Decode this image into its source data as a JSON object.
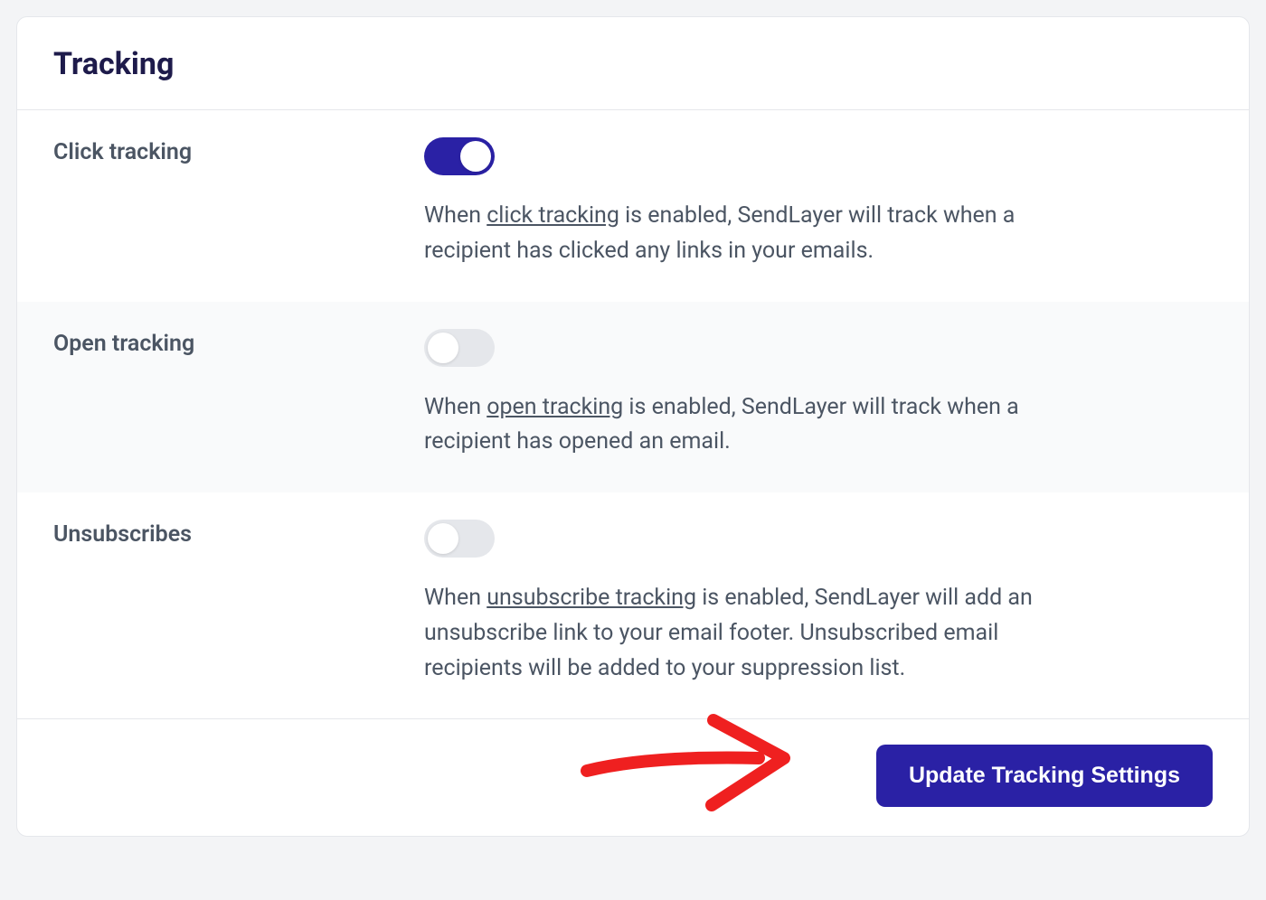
{
  "header": {
    "title": "Tracking"
  },
  "settings": {
    "click": {
      "label": "Click tracking",
      "enabled": true,
      "desc_pre": "When ",
      "desc_link": "click tracking",
      "desc_post": " is enabled, SendLayer will track when a recipient has clicked any links in your emails."
    },
    "open": {
      "label": "Open tracking",
      "enabled": false,
      "desc_pre": "When ",
      "desc_link": "open tracking",
      "desc_post": " is enabled, SendLayer will track when a recipient has opened an email."
    },
    "unsub": {
      "label": "Unsubscribes",
      "enabled": false,
      "desc_pre": "When ",
      "desc_link": "unsubscribe tracking",
      "desc_post": " is enabled, SendLayer will add an unsubscribe link to your email footer. Unsubscribed email recipients will be added to your suppression list."
    }
  },
  "footer": {
    "update_label": "Update Tracking Settings"
  },
  "colors": {
    "accent": "#2a21a5",
    "annotation": "#ef2020"
  }
}
